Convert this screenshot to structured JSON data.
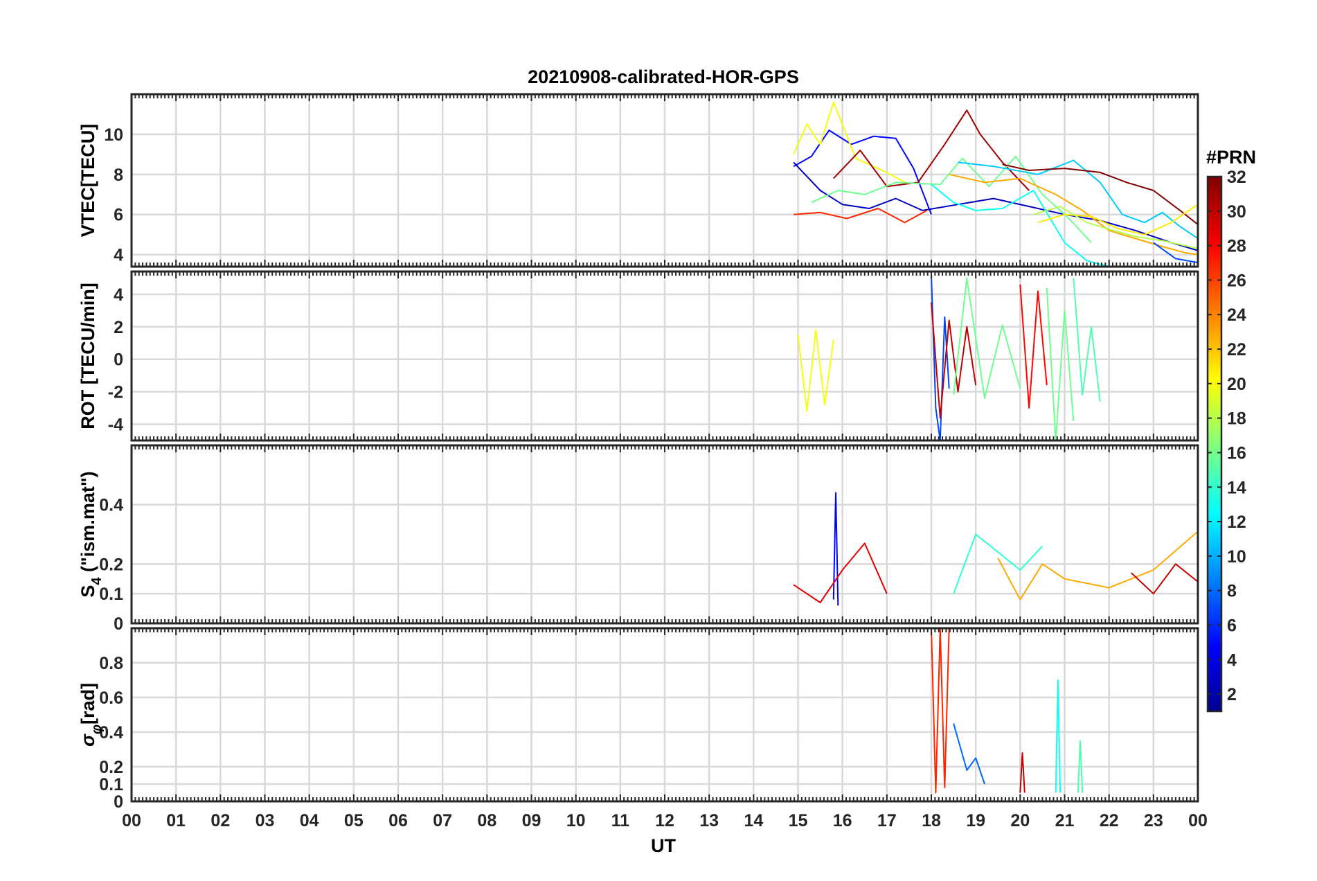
{
  "title": "20210908-calibrated-HOR-GPS",
  "xlabel": "UT",
  "x_ticks": [
    "00",
    "01",
    "02",
    "03",
    "04",
    "05",
    "06",
    "07",
    "08",
    "09",
    "10",
    "11",
    "12",
    "13",
    "14",
    "15",
    "16",
    "17",
    "18",
    "19",
    "20",
    "21",
    "22",
    "23",
    "00"
  ],
  "colorbar": {
    "label": "#PRN",
    "ticks": [
      "2",
      "4",
      "6",
      "8",
      "10",
      "12",
      "14",
      "16",
      "18",
      "20",
      "22",
      "24",
      "26",
      "28",
      "30",
      "32"
    ],
    "range": [
      1,
      32
    ],
    "colormap": "jet"
  },
  "panels": [
    {
      "id": "vtec",
      "ylabel": "VTEC[TECU]",
      "ylim": [
        3.4,
        12
      ],
      "yticks": [
        "4",
        "6",
        "8",
        "10"
      ]
    },
    {
      "id": "rot",
      "ylabel": "ROT [TECU/min]",
      "ylim": [
        -5,
        5.4
      ],
      "yticks": [
        "-4",
        "-2",
        "0",
        "2",
        "4"
      ]
    },
    {
      "id": "s4",
      "ylabel_main": "S",
      "ylabel_sub": "4",
      "ylabel_rest": " (\"ism.mat\")",
      "ylim": [
        0,
        0.6
      ],
      "yticks": [
        "0",
        "0.1",
        "0.2",
        "0.4"
      ]
    },
    {
      "id": "sigma",
      "ylabel_main": "σ",
      "ylabel_sub": "φ",
      "ylabel_rest": "[rad]",
      "ylim": [
        0,
        1
      ],
      "yticks": [
        "0",
        "0.1",
        "0.2",
        "0.4",
        "0.6",
        "0.8"
      ]
    }
  ],
  "chart_data": [
    {
      "type": "line",
      "title": "20210908-calibrated-HOR-GPS",
      "ylabel": "VTEC[TECU]",
      "x_range_hours": [
        0,
        24
      ],
      "ylim": [
        3.4,
        12
      ],
      "grid": true,
      "series": [
        {
          "prn": 5,
          "x": [
            14.9,
            15.3,
            15.7,
            16.2,
            16.7,
            17.2,
            17.6,
            18.0
          ],
          "y": [
            8.4,
            8.9,
            10.2,
            9.5,
            9.9,
            9.8,
            8.3,
            6.0
          ]
        },
        {
          "prn": 3,
          "x": [
            14.9,
            15.5,
            16.0,
            16.6,
            17.2,
            17.8,
            18.6,
            19.4,
            20.2,
            21.0,
            21.8,
            22.6,
            23.4,
            24.0
          ],
          "y": [
            8.6,
            7.2,
            6.5,
            6.3,
            6.8,
            6.2,
            6.5,
            6.8,
            6.4,
            6.0,
            5.7,
            5.2,
            4.6,
            4.2
          ]
        },
        {
          "prn": 20,
          "x": [
            14.9,
            15.2,
            15.5,
            15.8,
            16.3,
            16.9,
            17.5
          ],
          "y": [
            9.0,
            10.5,
            9.5,
            11.6,
            8.8,
            8.2,
            7.5
          ]
        },
        {
          "prn": 31,
          "x": [
            15.8,
            16.4,
            17.0,
            17.7,
            18.3,
            18.8,
            19.1,
            19.6,
            20.2
          ],
          "y": [
            7.8,
            9.2,
            7.4,
            7.6,
            9.5,
            11.2,
            10.0,
            8.6,
            7.2
          ]
        },
        {
          "prn": 27,
          "x": [
            14.9,
            15.5,
            16.1,
            16.8,
            17.4,
            17.9
          ],
          "y": [
            6.0,
            6.1,
            5.8,
            6.3,
            5.6,
            6.2
          ]
        },
        {
          "prn": 16,
          "x": [
            15.3,
            15.9,
            16.5,
            17.2,
            18.2,
            18.7,
            19.3,
            19.9,
            20.5,
            21.1,
            21.6
          ],
          "y": [
            6.6,
            7.2,
            7.0,
            7.6,
            7.5,
            8.8,
            7.4,
            8.9,
            7.0,
            5.8,
            4.6
          ]
        },
        {
          "prn": 13,
          "x": [
            18.0,
            18.5,
            19.0,
            19.6,
            20.3,
            21.0,
            21.5,
            22.0
          ],
          "y": [
            7.5,
            6.6,
            6.2,
            6.3,
            7.2,
            4.6,
            3.7,
            3.4
          ]
        },
        {
          "prn": 11,
          "x": [
            18.6,
            19.4,
            20.4,
            21.2,
            21.8,
            22.3,
            22.8,
            23.2,
            23.6,
            24.0
          ],
          "y": [
            8.6,
            8.4,
            8.0,
            8.7,
            7.6,
            6.0,
            5.6,
            6.1,
            5.4,
            4.8
          ]
        },
        {
          "prn": 23,
          "x": [
            18.4,
            19.2,
            20.0,
            20.8,
            21.4,
            22.0,
            22.6,
            23.2,
            23.7,
            24.0
          ],
          "y": [
            8.0,
            7.6,
            7.8,
            7.0,
            6.2,
            5.2,
            4.8,
            4.4,
            4.1,
            4.0
          ]
        },
        {
          "prn": 32,
          "x": [
            19.6,
            20.2,
            21.0,
            21.8,
            22.4,
            23.0,
            23.6,
            24.0
          ],
          "y": [
            8.5,
            8.2,
            8.3,
            8.1,
            7.6,
            7.2,
            6.2,
            5.5
          ]
        },
        {
          "prn": 21,
          "x": [
            20.4,
            21.0,
            21.6,
            22.2,
            22.8,
            23.4,
            24.0
          ],
          "y": [
            5.6,
            6.0,
            5.9,
            5.3,
            5.0,
            5.6,
            6.5
          ]
        },
        {
          "prn": 18,
          "x": [
            20.3,
            20.9,
            21.5,
            22.1,
            22.6,
            23.2,
            23.8,
            24.0
          ],
          "y": [
            6.0,
            6.4,
            5.6,
            5.2,
            4.9,
            4.7,
            4.4,
            4.3
          ]
        },
        {
          "prn": 7,
          "x": [
            23.0,
            23.5,
            24.0
          ],
          "y": [
            4.6,
            3.8,
            3.6
          ]
        }
      ]
    },
    {
      "type": "line",
      "ylabel": "ROT [TECU/min]",
      "x_range_hours": [
        0,
        24
      ],
      "ylim": [
        -5,
        5.4
      ],
      "grid": true,
      "series": [
        {
          "prn": 20,
          "x": [
            15.0,
            15.2,
            15.4,
            15.6,
            15.8
          ],
          "y": [
            1.5,
            -3.2,
            1.8,
            -2.8,
            1.2
          ]
        },
        {
          "prn": 7,
          "x": [
            18.0,
            18.1,
            18.2,
            18.3,
            18.4
          ],
          "y": [
            5.2,
            -3.0,
            -5.0,
            2.6,
            -1.8
          ]
        },
        {
          "prn": 30,
          "x": [
            18.0,
            18.2,
            18.4,
            18.6,
            18.8,
            19.0
          ],
          "y": [
            3.5,
            -3.6,
            2.4,
            -2.0,
            2.0,
            -1.6
          ]
        },
        {
          "prn": 16,
          "x": [
            18.5,
            18.8,
            19.2,
            19.6,
            20.0
          ],
          "y": [
            -2.2,
            5.0,
            -2.4,
            2.1,
            -1.8
          ]
        },
        {
          "prn": 28,
          "x": [
            20.0,
            20.2,
            20.4,
            20.6
          ],
          "y": [
            4.6,
            -3.0,
            4.2,
            -1.6
          ]
        },
        {
          "prn": 16,
          "x": [
            20.6,
            20.8,
            21.0,
            21.2
          ],
          "y": [
            4.4,
            -5.0,
            3.0,
            -3.8
          ]
        },
        {
          "prn": 15,
          "x": [
            21.2,
            21.4,
            21.6,
            21.8
          ],
          "y": [
            5.0,
            -2.2,
            2.0,
            -2.6
          ]
        }
      ]
    },
    {
      "type": "line",
      "ylabel": "S4 (\"ism.mat\")",
      "x_range_hours": [
        0,
        24
      ],
      "ylim": [
        0,
        0.6
      ],
      "grid": true,
      "series": [
        {
          "prn": 5,
          "x": [
            15.8,
            15.85,
            15.9
          ],
          "y": [
            0.08,
            0.44,
            0.06
          ]
        },
        {
          "prn": 29,
          "x": [
            14.9,
            15.5,
            16.0,
            16.5,
            17.0
          ],
          "y": [
            0.13,
            0.07,
            0.18,
            0.27,
            0.1
          ]
        },
        {
          "prn": 14,
          "x": [
            18.5,
            19.0,
            19.5,
            20.0,
            20.5
          ],
          "y": [
            0.1,
            0.3,
            0.24,
            0.18,
            0.26
          ]
        },
        {
          "prn": 23,
          "x": [
            19.5,
            20.0,
            20.5,
            21.0,
            22.0,
            23.0,
            24.0
          ],
          "y": [
            0.22,
            0.08,
            0.2,
            0.15,
            0.12,
            0.18,
            0.31
          ]
        },
        {
          "prn": 30,
          "x": [
            22.5,
            23.0,
            23.5,
            24.0
          ],
          "y": [
            0.17,
            0.1,
            0.2,
            0.14
          ]
        }
      ]
    },
    {
      "type": "line",
      "ylabel": "σφ[rad]",
      "x_range_hours": [
        0,
        24
      ],
      "ylim": [
        0,
        1
      ],
      "grid": true,
      "series": [
        {
          "prn": 27,
          "x": [
            18.0,
            18.1,
            18.2,
            18.3,
            18.4
          ],
          "y": [
            1.0,
            0.05,
            1.0,
            0.08,
            1.0
          ]
        },
        {
          "prn": 8,
          "x": [
            18.5,
            18.8,
            19.0,
            19.2
          ],
          "y": [
            0.45,
            0.18,
            0.25,
            0.1
          ]
        },
        {
          "prn": 13,
          "x": [
            20.8,
            20.85,
            20.9
          ],
          "y": [
            0.05,
            0.7,
            0.05
          ]
        },
        {
          "prn": 15,
          "x": [
            21.3,
            21.35,
            21.4
          ],
          "y": [
            0.05,
            0.35,
            0.05
          ]
        },
        {
          "prn": 30,
          "x": [
            20.0,
            20.05,
            20.1
          ],
          "y": [
            0.05,
            0.28,
            0.05
          ]
        }
      ]
    }
  ]
}
